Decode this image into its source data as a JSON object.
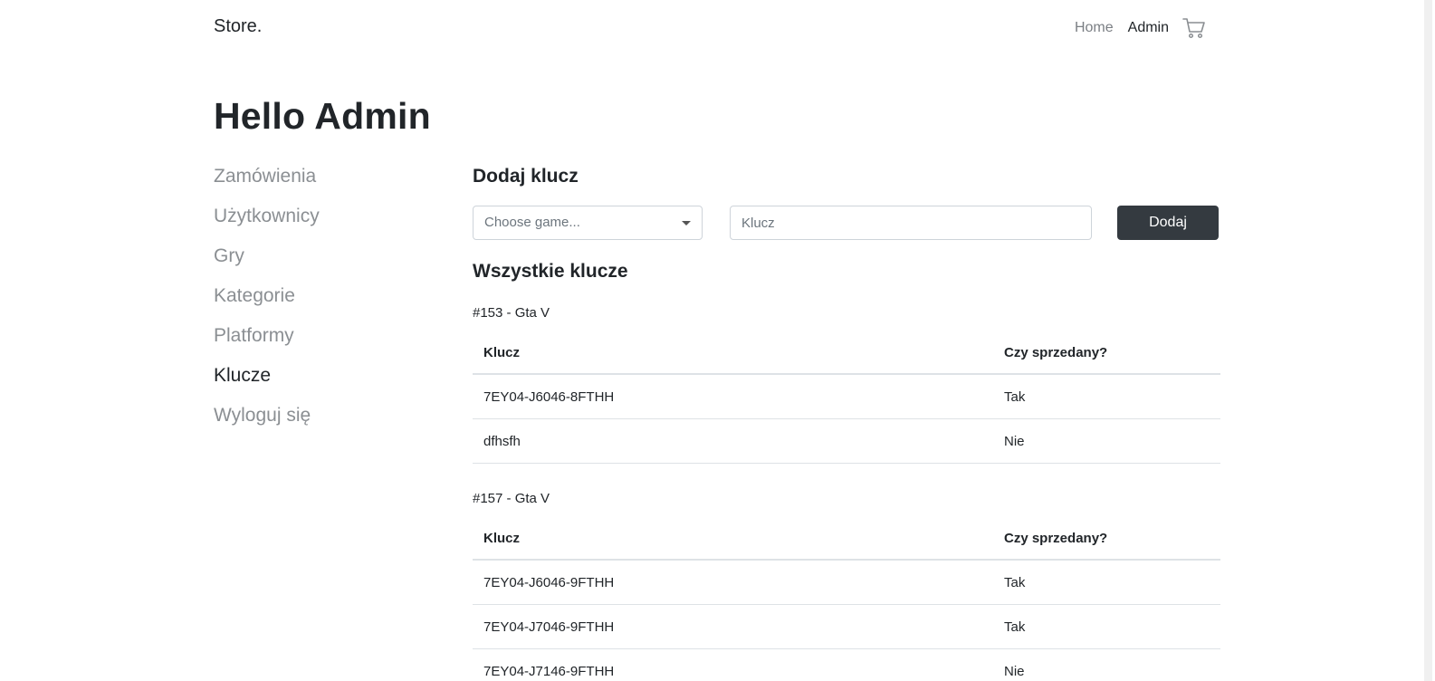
{
  "navbar": {
    "brand": "Store.",
    "links": [
      {
        "label": "Home",
        "active": false
      },
      {
        "label": "Admin",
        "active": true
      }
    ],
    "cart_icon": "cart-icon"
  },
  "page_title": "Hello Admin",
  "sidebar": {
    "items": [
      {
        "label": "Zamówienia",
        "active": false
      },
      {
        "label": "Użytkownicy",
        "active": false
      },
      {
        "label": "Gry",
        "active": false
      },
      {
        "label": "Kategorie",
        "active": false
      },
      {
        "label": "Platformy",
        "active": false
      },
      {
        "label": "Klucze",
        "active": true
      },
      {
        "label": "Wyloguj się",
        "active": false
      }
    ]
  },
  "add_key": {
    "title": "Dodaj klucz",
    "game_select_value": "Choose game...",
    "key_placeholder": "Klucz",
    "submit_label": "Dodaj"
  },
  "all_keys": {
    "title": "Wszystkie klucze",
    "columns": {
      "key": "Klucz",
      "sold": "Czy sprzedany?"
    },
    "groups": [
      {
        "label": "#153 - Gta V",
        "rows": [
          {
            "key": "7EY04-J6046-8FTHH",
            "sold": "Tak"
          },
          {
            "key": "dfhsfh",
            "sold": "Nie"
          }
        ]
      },
      {
        "label": "#157 - Gta V",
        "rows": [
          {
            "key": "7EY04-J6046-9FTHH",
            "sold": "Tak"
          },
          {
            "key": "7EY04-J7046-9FTHH",
            "sold": "Tak"
          },
          {
            "key": "7EY04-J7146-9FTHH",
            "sold": "Nie"
          }
        ]
      }
    ]
  },
  "colors": {
    "text_primary": "#212529",
    "text_muted": "#8b8f93",
    "button_dark": "#343a40",
    "border": "#dee2e6"
  }
}
